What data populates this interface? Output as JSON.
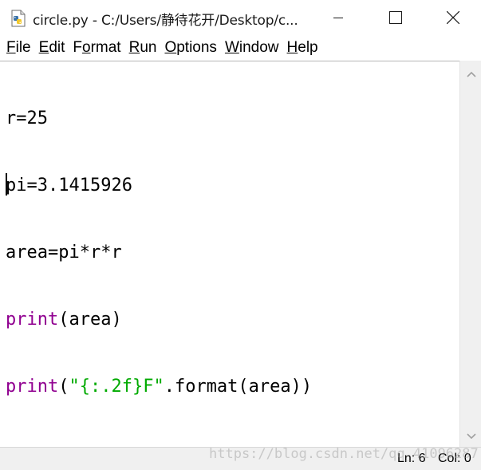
{
  "window": {
    "title": "circle.py - C:/Users/静待花开/Desktop/c..."
  },
  "menu": {
    "items": [
      {
        "label": "File",
        "mnemonic": "F",
        "rest": "ile"
      },
      {
        "label": "Edit",
        "mnemonic": "E",
        "rest": "dit"
      },
      {
        "label": "Format",
        "pre": "F",
        "mnemonic": "o",
        "rest": "rmat"
      },
      {
        "label": "Run",
        "mnemonic": "R",
        "rest": "un"
      },
      {
        "label": "Options",
        "mnemonic": "O",
        "rest": "ptions"
      },
      {
        "label": "Window",
        "mnemonic": "W",
        "rest": "indow"
      },
      {
        "label": "Help",
        "mnemonic": "H",
        "rest": "elp"
      }
    ]
  },
  "editor": {
    "lines": [
      [
        {
          "t": "r=25",
          "c": "plain"
        }
      ],
      [
        {
          "t": "pi=3.1415926",
          "c": "plain"
        }
      ],
      [
        {
          "t": "area=pi*r*r",
          "c": "plain"
        }
      ],
      [
        {
          "t": "print",
          "c": "kw"
        },
        {
          "t": "(area)",
          "c": "plain"
        }
      ],
      [
        {
          "t": "print",
          "c": "kw"
        },
        {
          "t": "(",
          "c": "plain"
        },
        {
          "t": "\"{:.2f}F\"",
          "c": "str"
        },
        {
          "t": ".format(area))",
          "c": "plain"
        }
      ]
    ],
    "colors": {
      "keyword": "#900090",
      "string": "#00aa00",
      "text": "#000000"
    }
  },
  "status": {
    "line": "Ln: 6",
    "col": "Col: 0"
  },
  "watermark": {
    "text": "https://blog.csdn.net/qq_41096287"
  },
  "icons": {
    "app": "python-file-icon",
    "minimize": "minimize-icon",
    "maximize": "maximize-icon",
    "close": "close-icon",
    "scroll_up": "chevron-up-icon",
    "scroll_down": "chevron-down-icon"
  }
}
